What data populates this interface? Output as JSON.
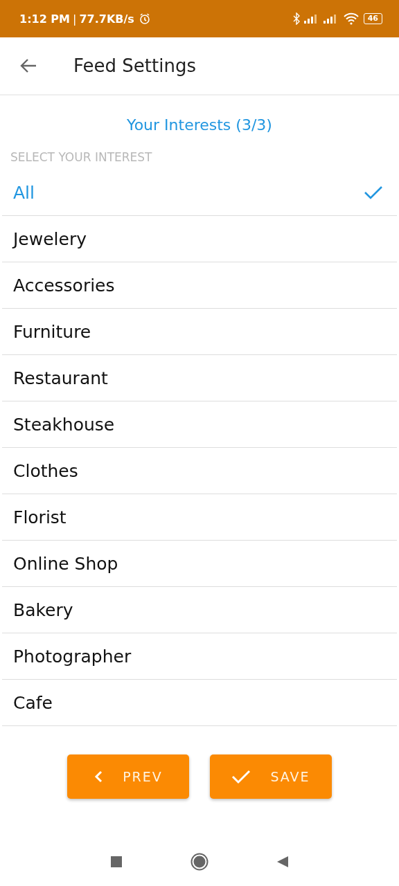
{
  "status_bar": {
    "time": "1:12 PM",
    "separator": "|",
    "speed": "77.7KB/s",
    "battery": "46"
  },
  "header": {
    "title": "Feed Settings"
  },
  "interests_title": "Your Interests (3/3)",
  "section_label": "SELECT YOUR INTEREST",
  "items": [
    {
      "label": "All",
      "selected": true
    },
    {
      "label": "Jewelery",
      "selected": false
    },
    {
      "label": "Accessories",
      "selected": false
    },
    {
      "label": "Furniture",
      "selected": false
    },
    {
      "label": "Restaurant",
      "selected": false
    },
    {
      "label": "Steakhouse",
      "selected": false
    },
    {
      "label": "Clothes",
      "selected": false
    },
    {
      "label": "Florist",
      "selected": false
    },
    {
      "label": "Online Shop",
      "selected": false
    },
    {
      "label": "Bakery",
      "selected": false
    },
    {
      "label": "Photographer",
      "selected": false
    },
    {
      "label": "Cafe",
      "selected": false
    }
  ],
  "buttons": [
    {
      "kind": "prev",
      "label": "PREV"
    },
    {
      "kind": "save",
      "label": "SAVE"
    }
  ]
}
